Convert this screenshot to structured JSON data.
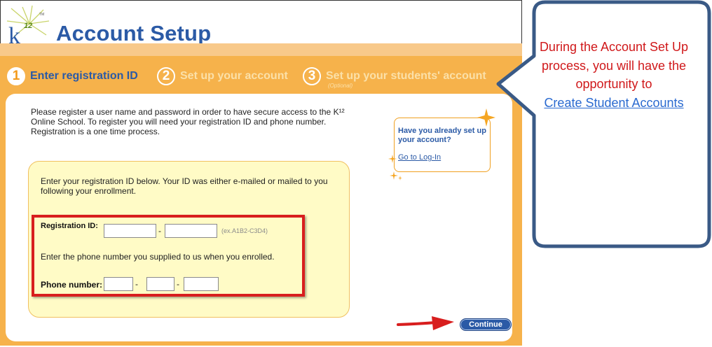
{
  "header": {
    "logo_text": "K12",
    "title": "Account Setup"
  },
  "steps": [
    {
      "number": "1",
      "label": "Enter registration ID",
      "active": true
    },
    {
      "number": "2",
      "label": "Set up your account",
      "active": false
    },
    {
      "number": "3",
      "label": "Set up your students' account",
      "sub": "(Optional)",
      "active": false
    }
  ],
  "intro_text": "Please register a user name and password in order to have secure access to the K¹² Online School. To register you will need your registration ID and phone number. Registration is a one time process.",
  "login_callout": {
    "question": "Have you already set up your account?",
    "link": "Go to Log-In"
  },
  "registration": {
    "instructions": "Enter your registration ID below. Your ID was either e-mailed or mailed to you following your enrollment.",
    "id_label": "Registration ID:",
    "id_part1": "",
    "id_part2": "",
    "id_hint": "(ex.A1B2-C3D4)",
    "separator": "-",
    "phone_instructions": "Enter the phone number you supplied to us when you enrolled.",
    "phone_label": "Phone number:",
    "phone_area": "",
    "phone_prefix": "",
    "phone_line": ""
  },
  "continue_button": "Continue",
  "speech_bubble": {
    "text": "During the Account Set Up process, you will have the opportunity to",
    "link": "Create Student Accounts"
  },
  "colors": {
    "brand_blue": "#2b5aa6",
    "orange": "#f6b24b",
    "highlight_red": "#d81e1e",
    "bubble_border": "#3a5a86"
  }
}
